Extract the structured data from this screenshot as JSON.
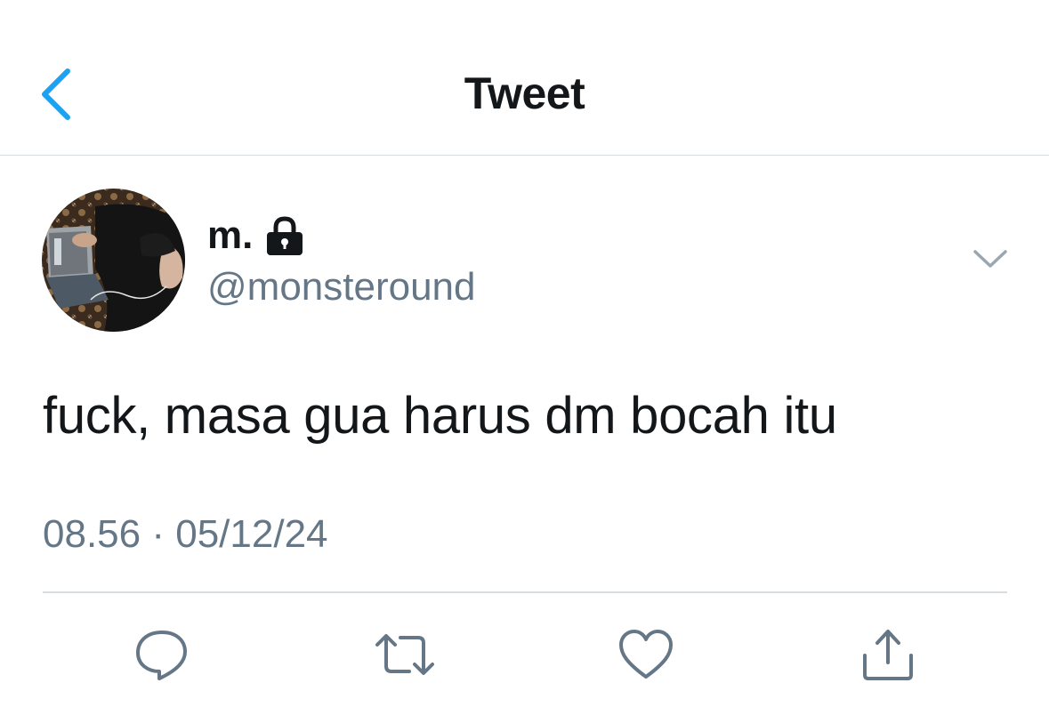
{
  "navbar": {
    "back_icon": "chevron-left-icon",
    "title": "Tweet"
  },
  "tweet": {
    "display_name": "m.",
    "protected_icon": "lock-icon",
    "handle": "@monsteround",
    "menu_icon": "chevron-down-icon",
    "text": "fuck, masa gua harus dm bocah itu",
    "time": "08.56",
    "separator": "·",
    "date": "05/12/24"
  },
  "actions": [
    {
      "icon": "reply-icon"
    },
    {
      "icon": "retweet-icon"
    },
    {
      "icon": "like-icon"
    },
    {
      "icon": "share-icon"
    }
  ],
  "colors": {
    "accent": "#1da1f2",
    "text_primary": "#14171a",
    "text_secondary": "#657786",
    "divider": "#d8dde2"
  }
}
